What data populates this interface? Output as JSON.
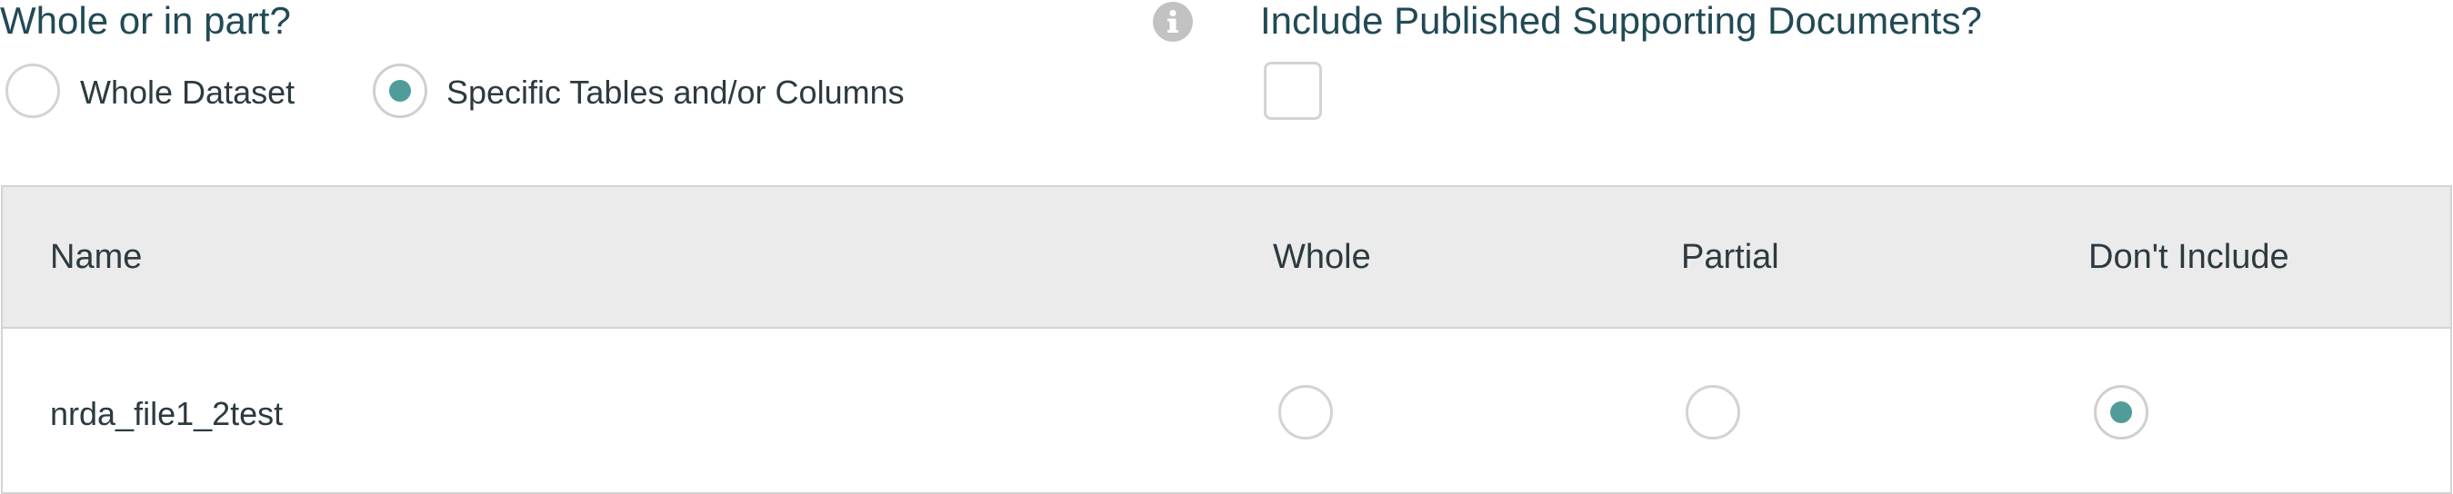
{
  "scope": {
    "heading": "Whole or in part?",
    "options": [
      {
        "label": "Whole Dataset",
        "selected": false
      },
      {
        "label": "Specific Tables and/or Columns",
        "selected": true
      }
    ]
  },
  "info_icon": "info-circle-icon",
  "supporting_docs": {
    "heading": "Include Published Supporting Documents?",
    "checked": false
  },
  "table": {
    "columns": [
      "Name",
      "Whole",
      "Partial",
      "Don't Include"
    ],
    "rows": [
      {
        "name": "nrda_file1_2test",
        "selection": "Don't Include"
      }
    ]
  },
  "colors": {
    "accent": "#4f9c9a",
    "heading": "#214a55",
    "header_bg": "#ebebeb",
    "border": "#d3d3d3"
  }
}
